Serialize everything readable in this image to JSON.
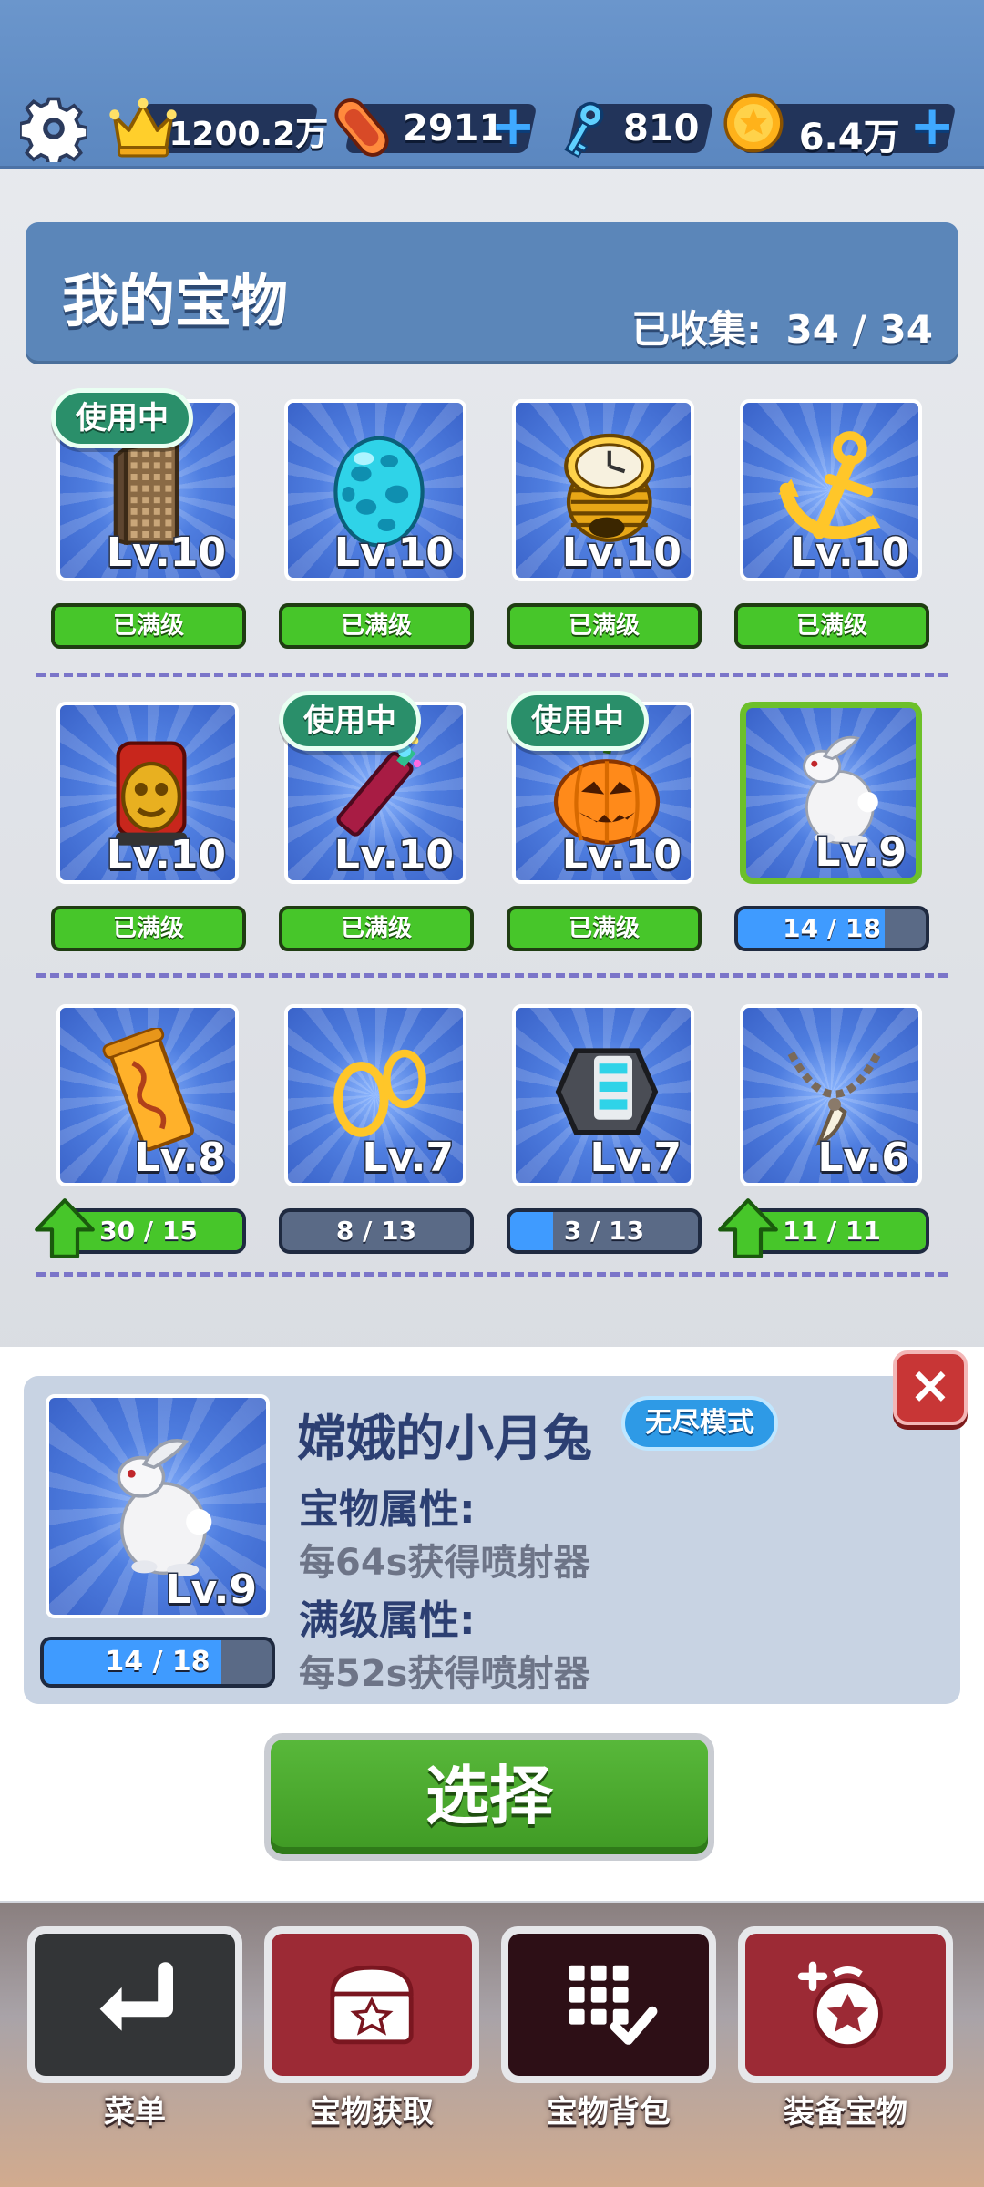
{
  "topbar": {
    "settings_icon": "gear-icon",
    "trophy_value": "1200.2万",
    "boards_value": "2911",
    "keys_value": "810",
    "coins_value": "6.4万",
    "plus": "+"
  },
  "header": {
    "title": "我的宝物",
    "collected_label": "已收集:",
    "collected_value": "34 / 34"
  },
  "items": [
    {
      "icon": "tower-icon",
      "level": "Lv.10",
      "badge": "使用中",
      "status": "已满级"
    },
    {
      "icon": "egg-icon",
      "level": "Lv.10",
      "badge": "",
      "status": "已满级"
    },
    {
      "icon": "clock-icon",
      "level": "Lv.10",
      "badge": "",
      "status": "已满级"
    },
    {
      "icon": "anchor-icon",
      "level": "Lv.10",
      "badge": "",
      "status": "已满级"
    },
    {
      "icon": "mask-icon",
      "level": "Lv.10",
      "badge": "",
      "status": "已满级"
    },
    {
      "icon": "firework-icon",
      "level": "Lv.10",
      "badge": "使用中",
      "status": "已满级"
    },
    {
      "icon": "pumpkin-icon",
      "level": "Lv.10",
      "badge": "使用中",
      "status": "已满级"
    },
    {
      "icon": "rabbit-icon",
      "level": "Lv.9",
      "badge": "",
      "progress": "14 / 18",
      "fill": 0.78
    },
    {
      "icon": "scroll-icon",
      "level": "Lv.8",
      "badge": "",
      "progress": "30 / 15",
      "fill": 1.0,
      "upgrade": true
    },
    {
      "icon": "rings-icon",
      "level": "Lv.7",
      "badge": "",
      "progress": "8 / 13",
      "fill": 0.0
    },
    {
      "icon": "gadget-icon",
      "level": "Lv.7",
      "badge": "",
      "progress": "3 / 13",
      "fill": 0.23
    },
    {
      "icon": "necklace-icon",
      "level": "Lv.6",
      "badge": "",
      "progress": "11 / 11",
      "fill": 1.0,
      "upgrade": true
    }
  ],
  "detail": {
    "icon": "rabbit-icon",
    "name": "嫦娥的小月兔",
    "mode": "无尽模式",
    "level": "Lv.9",
    "progress": "14 / 18",
    "fill": 0.78,
    "attr_label": "宝物属性:",
    "attr_value": "每64s获得喷射器",
    "max_label": "满级属性:",
    "max_value": "每52s获得喷射器",
    "close": "×",
    "select_label": "选择"
  },
  "nav": [
    {
      "icon": "return-icon",
      "label": "菜单",
      "color": "#333537"
    },
    {
      "icon": "chest-icon",
      "label": "宝物获取",
      "color": "#9c2a35"
    },
    {
      "icon": "grid-check-icon",
      "label": "宝物背包",
      "color": "#2d0f16"
    },
    {
      "icon": "equip-treasure-icon",
      "label": "装备宝物",
      "color": "#9c2a35"
    }
  ]
}
